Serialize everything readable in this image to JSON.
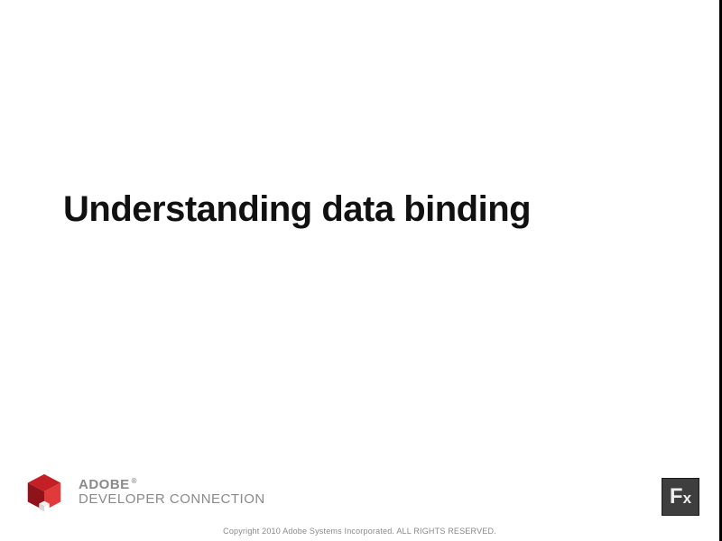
{
  "title": "Understanding data binding",
  "footer": {
    "brand": "ADOBE",
    "registered": "®",
    "subbrand": "DEVELOPER CONNECTION",
    "copyright": "Copyright 2010 Adobe Systems Incorporated. ALL RIGHTS RESERVED.",
    "fx_label": "Fx"
  }
}
